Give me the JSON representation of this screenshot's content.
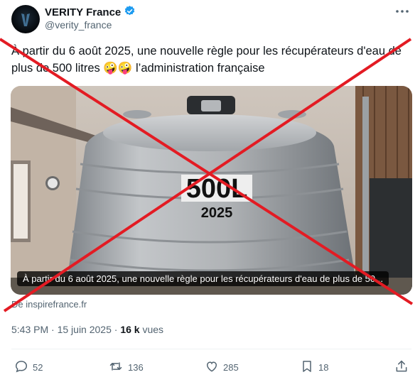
{
  "post": {
    "author_name": "VERITY France",
    "handle": "@verity_france",
    "text": "À partir du 6 août 2025, une nouvelle règle pour les récupérateurs d'eau de plus de 500 litres 🤪🤪 l’administration française"
  },
  "media": {
    "tank_label_volume": "500L",
    "tank_label_year": "2025",
    "caption": "À partir du 6 août 2025, une nouvelle règle pour les récupérateurs d'eau de plus de 50...",
    "source": "De inspirefrance.fr"
  },
  "meta": {
    "time_date": "5:43 PM · 15 juin 2025 · ",
    "views_count": "16 k",
    "views_label": " vues"
  },
  "actions": {
    "replies": "52",
    "reposts": "136",
    "likes": "285",
    "bookmarks": "18"
  },
  "colors": {
    "verified_blue": "#1d9bf0",
    "overlay_red": "#e31b23",
    "muted_text": "#536471"
  },
  "icons": [
    "verified-badge-icon",
    "more-options-icon",
    "reply-icon",
    "repost-icon",
    "like-icon",
    "bookmark-icon",
    "share-icon"
  ]
}
